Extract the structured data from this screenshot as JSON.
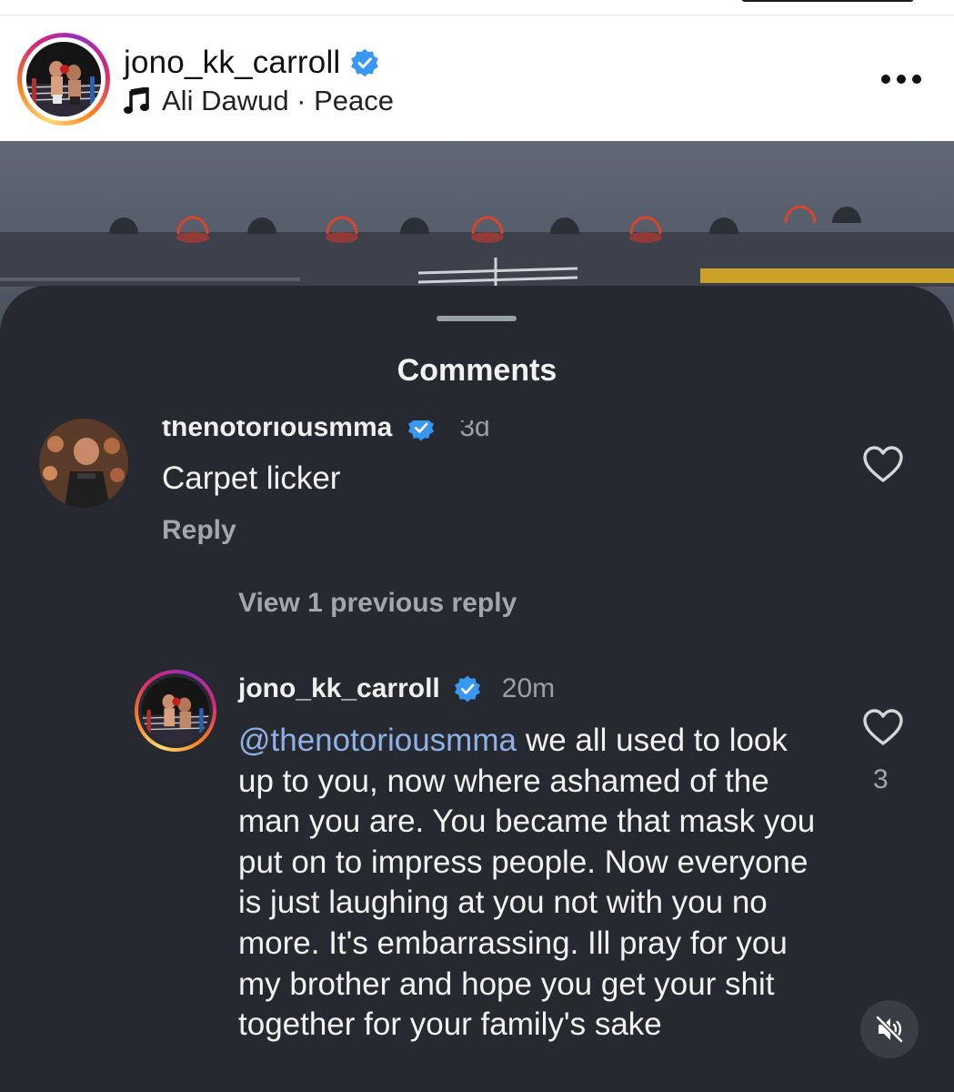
{
  "post": {
    "username": "jono_kk_carroll",
    "music": "Ali Dawud · Peace",
    "icons": {
      "verified": "verified-badge-icon",
      "music": "music-note-icon",
      "more": "more-options-icon"
    }
  },
  "comments_sheet": {
    "title": "Comments",
    "comments": [
      {
        "username": "thenotoriousmma",
        "time": "3d",
        "text": "Carpet licker",
        "reply_label": "Reply"
      }
    ],
    "view_replies": "View 1 previous reply",
    "reply": {
      "username": "jono_kk_carroll",
      "time": "20m",
      "mention": "@thenotoriousmma",
      "text": "we all used to look up to you, now where ashamed of the man you are. You became that mask you put on to impress people. Now everyone is just laughing at you not with you no more. It's embarrassing. Ill pray for you my brother and hope you get your shit together for your family's sake",
      "likes": "3"
    }
  },
  "controls": {
    "mute_icon": "muted-speaker-icon"
  },
  "colors": {
    "sheet_bg": "#262a30",
    "verified_blue": "#3897f0",
    "mention": "#8fb1e6"
  }
}
